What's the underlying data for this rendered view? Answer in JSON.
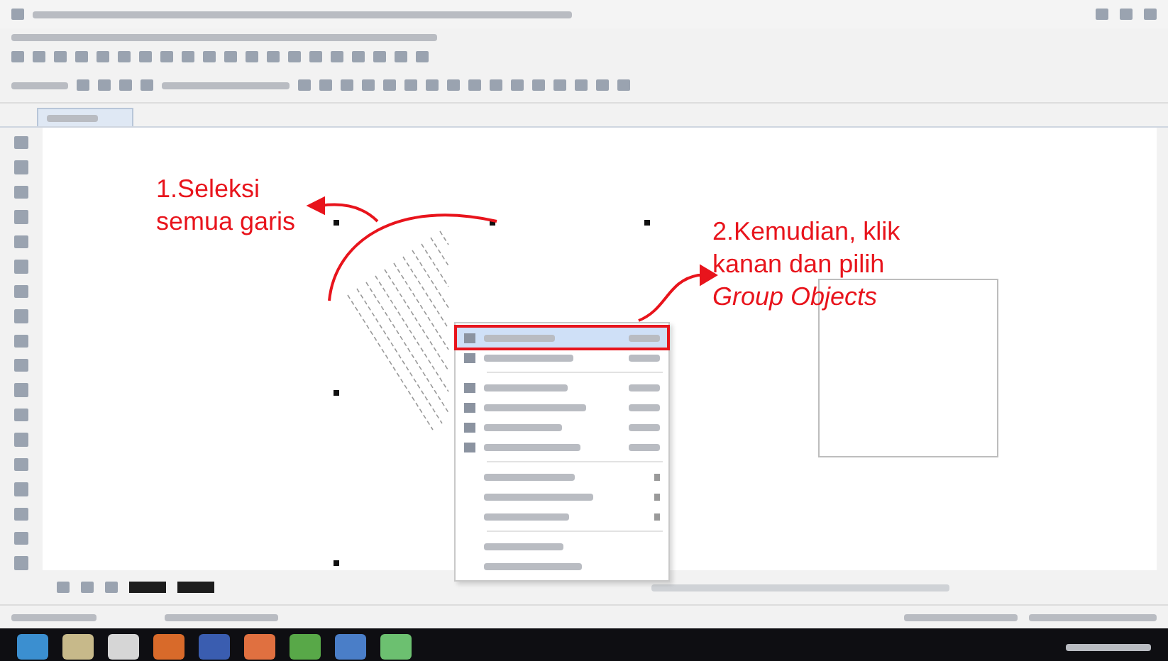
{
  "annotations": [
    {
      "lines": [
        "1.Seleksi",
        "semua garis"
      ]
    },
    {
      "lines": [
        "2.Kemudian, klik",
        "kanan dan pilih",
        "*Group Objects*"
      ]
    }
  ],
  "context_menu": {
    "items": [
      {
        "kind": "shortcut",
        "selected": true
      },
      {
        "kind": "shortcut",
        "selected": false
      },
      {
        "kind": "separator"
      },
      {
        "kind": "shortcut",
        "selected": false
      },
      {
        "kind": "shortcut",
        "selected": false
      },
      {
        "kind": "shortcut",
        "selected": false
      },
      {
        "kind": "shortcut",
        "selected": false
      },
      {
        "kind": "separator"
      },
      {
        "kind": "submenu",
        "selected": false
      },
      {
        "kind": "submenu",
        "selected": false
      },
      {
        "kind": "submenu",
        "selected": false
      },
      {
        "kind": "separator"
      },
      {
        "kind": "plain",
        "selected": false
      },
      {
        "kind": "plain",
        "selected": false
      }
    ]
  }
}
